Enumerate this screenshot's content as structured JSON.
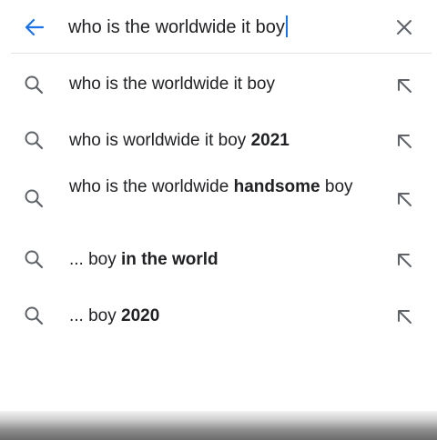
{
  "search": {
    "query": "who is the worldwide it boy",
    "back_icon": "arrow-left-icon",
    "clear_icon": "close-icon",
    "accent_color": "#1a73e8"
  },
  "suggestions": [
    {
      "plain": "who is the worldwide it boy",
      "bold": "",
      "tail": ""
    },
    {
      "plain": "who is worldwide it boy ",
      "bold": "2021",
      "tail": ""
    },
    {
      "plain": "who is the worldwide ",
      "bold": "handsome",
      "tail": " boy"
    },
    {
      "plain": "... boy ",
      "bold": "in the world",
      "tail": ""
    },
    {
      "plain": "... boy ",
      "bold": "2020",
      "tail": ""
    }
  ],
  "icons": {
    "suggestion_icon": "search-icon",
    "fill_icon": "arrow-up-left-icon"
  }
}
